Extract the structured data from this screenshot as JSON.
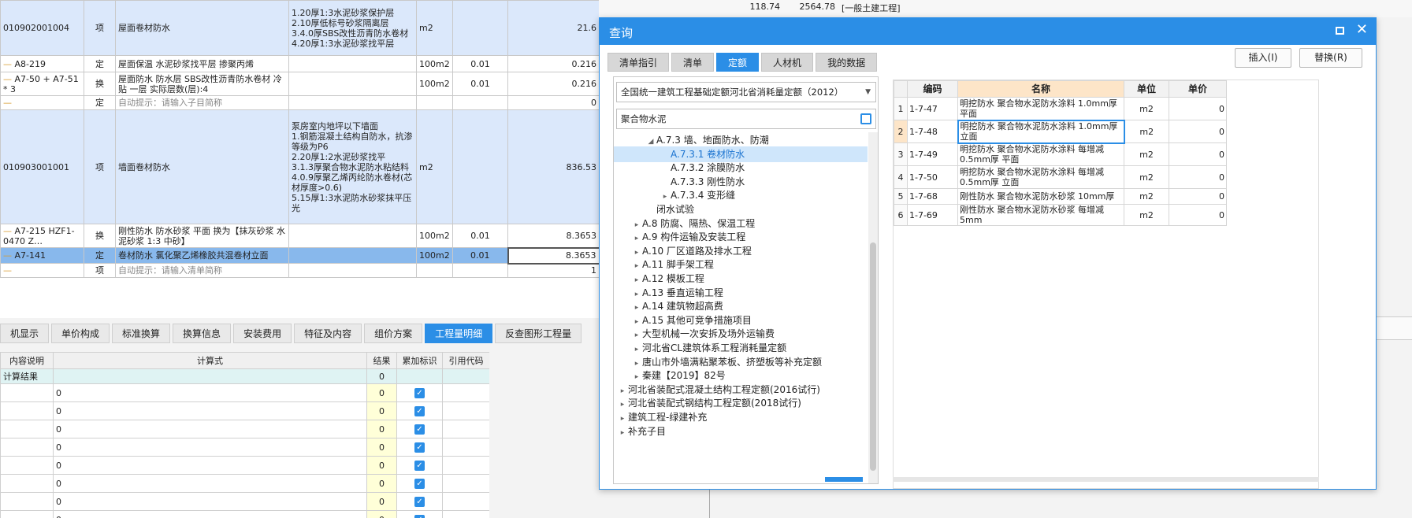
{
  "main_grid": {
    "rows": [
      {
        "kind": "qd",
        "code": "010902001004",
        "type": "项",
        "name": "屋面卷材防水",
        "feature": "1.20厚1:3水泥砂浆保护层\n2.10厚低标号砂浆隔离层\n3.4.0厚SBS改性沥青防水卷材\n4.20厚1:3水泥砂浆找平层",
        "unit": "m2",
        "qty_rate": "",
        "qty": "21.6"
      },
      {
        "kind": "de",
        "code": "A8-219",
        "type": "定",
        "name": "屋面保温 水泥砂浆找平层 掺聚丙烯",
        "feature": "",
        "unit": "100m2",
        "qty_rate": "0.01",
        "qty": "0.216"
      },
      {
        "kind": "de",
        "code": "A7-50 + A7-51 * 3",
        "type": "换",
        "name": "屋面防水 防水层 SBS改性沥青防水卷材 冷贴 一层  实际层数(层):4",
        "feature": "",
        "unit": "100m2",
        "qty_rate": "0.01",
        "qty": "0.216"
      },
      {
        "kind": "de",
        "code": "",
        "type": "定",
        "name": "自动提示：请输入子目简称",
        "feature": "",
        "unit": "",
        "qty_rate": "",
        "qty": "0"
      },
      {
        "kind": "qd",
        "code": "010903001001",
        "type": "项",
        "name": "墙面卷材防水",
        "feature": "泵房室内地坪以下墙面\n1.钢筋混凝土结构自防水，抗渗等级为P6\n2.20厚1:2水泥砂浆找平\n3.1.3厚聚合物水泥防水粘结料\n4.0.9厚聚乙烯丙纶防水卷材(芯材厚度>0.6)\n5.15厚1:3水泥防水砂浆抹平压光",
        "unit": "m2",
        "qty_rate": "",
        "qty": "836.53"
      },
      {
        "kind": "de",
        "code": "A7-215 HZF1-0470 Z…",
        "type": "换",
        "name": "刚性防水 防水砂浆 平面  换为【抹灰砂浆 水泥砂浆 1:3 中砂】",
        "feature": "",
        "unit": "100m2",
        "qty_rate": "0.01",
        "qty": "8.3653"
      },
      {
        "kind": "sel",
        "code": "A7-141",
        "type": "定",
        "name": "卷材防水 氯化聚乙烯橡胶共混卷材立面",
        "feature": "",
        "unit": "100m2",
        "qty_rate": "0.01",
        "qty": "8.3653"
      },
      {
        "kind": "de",
        "code": "",
        "type": "项",
        "name": "自动提示：请输入清单简称",
        "feature": "",
        "unit": "",
        "qty_rate": "",
        "qty": "1"
      }
    ],
    "right_partial": [
      "118.74",
      "2564.78",
      "[一般土建工程]"
    ]
  },
  "bottom_tabs": [
    "机显示",
    "单价构成",
    "标准换算",
    "换算信息",
    "安装费用",
    "特征及内容",
    "组价方案",
    "工程量明细",
    "反查图形工程量"
  ],
  "bottom_active": "工程量明细",
  "detail": {
    "headers": [
      "内容说明",
      "计算式",
      "结果",
      "累加标识",
      "引用代码"
    ],
    "result_label": "计算结果",
    "result_value": "0",
    "rows": [
      {
        "expr": "0",
        "result": "0"
      },
      {
        "expr": "0",
        "result": "0"
      },
      {
        "expr": "0",
        "result": "0"
      },
      {
        "expr": "0",
        "result": "0"
      },
      {
        "expr": "0",
        "result": "0"
      },
      {
        "expr": "0",
        "result": "0"
      },
      {
        "expr": "0",
        "result": "0"
      },
      {
        "expr": "0",
        "result": "0"
      }
    ]
  },
  "dialog": {
    "title": "查询",
    "tabs": [
      "清单指引",
      "清单",
      "定额",
      "人材机",
      "我的数据"
    ],
    "active_tab": "定额",
    "insert_button": "插入(I)",
    "replace_button": "替换(R)",
    "standard": "全国统一建筑工程基础定额河北省消耗量定额（2012）",
    "search_value": "聚合物水泥",
    "tree": [
      {
        "label": "A.7.3 墙、地面防水、防潮",
        "level": 2,
        "toggle": "down"
      },
      {
        "label": "A.7.3.1 卷材防水",
        "level": 3,
        "toggle": "",
        "selected": true
      },
      {
        "label": "A.7.3.2 涂膜防水",
        "level": 3,
        "toggle": ""
      },
      {
        "label": "A.7.3.3 刚性防水",
        "level": 3,
        "toggle": ""
      },
      {
        "label": "A.7.3.4 变形缝",
        "level": 3,
        "toggle": "right"
      },
      {
        "label": "闭水试验",
        "level": 2,
        "toggle": ""
      },
      {
        "label": "A.8 防腐、隔热、保温工程",
        "level": 1,
        "toggle": "right"
      },
      {
        "label": "A.9 构件运输及安装工程",
        "level": 1,
        "toggle": "right"
      },
      {
        "label": "A.10 厂区道路及排水工程",
        "level": 1,
        "toggle": "right"
      },
      {
        "label": "A.11 脚手架工程",
        "level": 1,
        "toggle": "right"
      },
      {
        "label": "A.12 模板工程",
        "level": 1,
        "toggle": "right"
      },
      {
        "label": "A.13 垂直运输工程",
        "level": 1,
        "toggle": "right"
      },
      {
        "label": "A.14 建筑物超高费",
        "level": 1,
        "toggle": "right"
      },
      {
        "label": "A.15 其他可竞争措施项目",
        "level": 1,
        "toggle": "right"
      },
      {
        "label": "大型机械一次安拆及场外运输费",
        "level": 1,
        "toggle": "right"
      },
      {
        "label": "河北省CL建筑体系工程消耗量定额",
        "level": 1,
        "toggle": "right"
      },
      {
        "label": "唐山市外墙满粘聚苯板、挤塑板等补充定额",
        "level": 1,
        "toggle": "right"
      },
      {
        "label": "秦建【2019】82号",
        "level": 1,
        "toggle": "right"
      },
      {
        "label": "河北省装配式混凝土结构工程定额(2016试行)",
        "level": 0,
        "toggle": "right"
      },
      {
        "label": "河北省装配式钢结构工程定额(2018试行)",
        "level": 0,
        "toggle": "right"
      },
      {
        "label": "建筑工程-绿建补充",
        "level": 0,
        "toggle": "right"
      },
      {
        "label": "补充子目",
        "level": 0,
        "toggle": "right"
      }
    ],
    "grid_headers": [
      "",
      "编码",
      "名称",
      "单位",
      "单价"
    ],
    "grid_rows": [
      {
        "idx": "1",
        "code": "1-7-47",
        "name": "明挖防水 聚合物水泥防水涂料 1.0mm厚 平面",
        "unit": "m2",
        "price": "0"
      },
      {
        "idx": "2",
        "code": "1-7-48",
        "name": "明挖防水 聚合物水泥防水涂料 1.0mm厚 立面",
        "unit": "m2",
        "price": "0"
      },
      {
        "idx": "3",
        "code": "1-7-49",
        "name": "明挖防水 聚合物水泥防水涂料 每增减0.5mm厚 平面",
        "unit": "m2",
        "price": "0"
      },
      {
        "idx": "4",
        "code": "1-7-50",
        "name": "明挖防水 聚合物水泥防水涂料 每增减0.5mm厚 立面",
        "unit": "m2",
        "price": "0"
      },
      {
        "idx": "5",
        "code": "1-7-68",
        "name": "刚性防水 聚合物水泥防水砂浆 10mm厚",
        "unit": "m2",
        "price": "0"
      },
      {
        "idx": "6",
        "code": "1-7-69",
        "name": "刚性防水 聚合物水泥防水砂浆 每增减5mm",
        "unit": "m2",
        "price": "0"
      }
    ]
  },
  "colors": {
    "accent": "#2b8ee6",
    "qd_row": "#dbe8fb",
    "selected_row": "#88b8ec",
    "tree_selected": "#cfe6fb"
  }
}
